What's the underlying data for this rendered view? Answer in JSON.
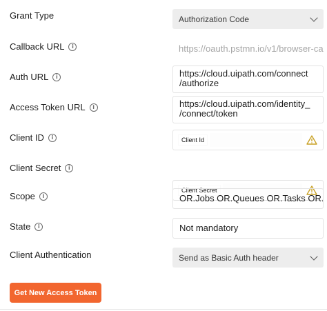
{
  "fields": {
    "grant_type": {
      "label": "Grant Type",
      "value": "Authorization Code"
    },
    "callback_url": {
      "label": "Callback URL",
      "value": "https://oauth.pstmn.io/v1/browser-ca"
    },
    "auth_url": {
      "label": "Auth URL",
      "value_line1": "https://cloud.uipath.com/connect",
      "value_line2": "/authorize"
    },
    "access_token_url": {
      "label": "Access Token URL",
      "value_line1": "https://cloud.uipath.com/identity_",
      "value_line2": "/connect/token"
    },
    "client_id": {
      "label": "Client ID",
      "value": "Client Id"
    },
    "client_secret": {
      "label": "Client Secret",
      "value": "Client Secret"
    },
    "scope": {
      "label": "Scope",
      "value": "OR.Jobs OR.Queues OR.Tasks OR.Fo..."
    },
    "state": {
      "label": "State",
      "value": "Not mandatory"
    },
    "client_authentication": {
      "label": "Client Authentication",
      "value": "Send as Basic Auth header"
    }
  },
  "button": {
    "label": "Get New Access Token",
    "color": "#f2662f"
  },
  "info_glyph": "i",
  "icons": {
    "info": "info-circle-icon",
    "warning": "warning-triangle-icon",
    "dropdown": "chevron-down-icon"
  }
}
